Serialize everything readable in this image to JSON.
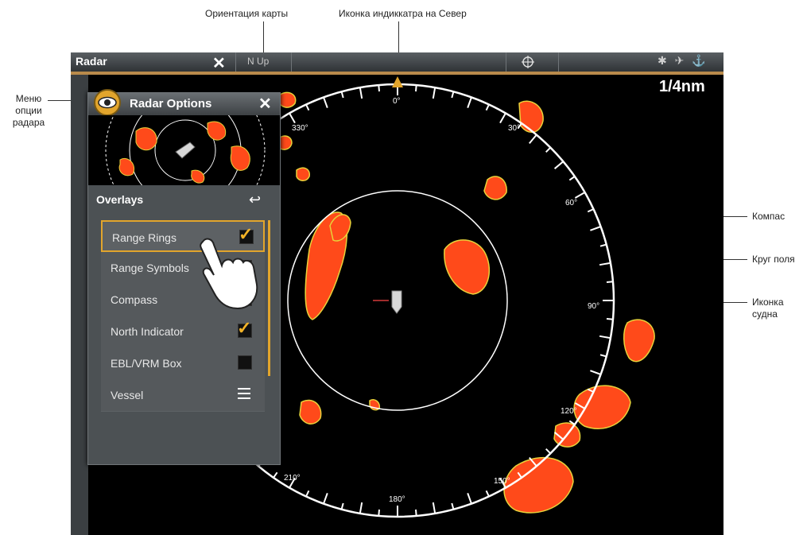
{
  "annotations": {
    "map_orientation": "Ориентация карты",
    "north_indicator_icon": "Иконка индиккатра на Север",
    "radar_options_menu": "Меню\nопции\nрадара",
    "compass": "Компас",
    "range_ring": "Круг поля",
    "vessel_icon": "Иконка\nсудна"
  },
  "topbar": {
    "title": "Radar",
    "close_glyph": "✕",
    "orientation": "N Up",
    "status_glyphs": "✱ ✈ ⚓"
  },
  "radar": {
    "range": "1/4nm",
    "compass_labels": [
      "0°",
      "30°",
      "60°",
      "90°",
      "120°",
      "150°",
      "180°",
      "210°",
      "330°"
    ]
  },
  "panel": {
    "title": "Radar Options",
    "close_glyph": "✕",
    "overlays_title": "Overlays",
    "back_glyph": "↩",
    "items": [
      {
        "label": "Range Rings",
        "checked": true
      },
      {
        "label": "Range Symbols",
        "checked": false
      },
      {
        "label": "Compass",
        "checked": true
      },
      {
        "label": "North Indicator",
        "checked": true
      },
      {
        "label": "EBL/VRM Box",
        "checked": false
      },
      {
        "label": "Vessel",
        "type": "menu"
      }
    ]
  },
  "colors": {
    "accent": "#e2a52c",
    "echo": "#ff4a1a",
    "echo_edge": "#e8d23a"
  }
}
